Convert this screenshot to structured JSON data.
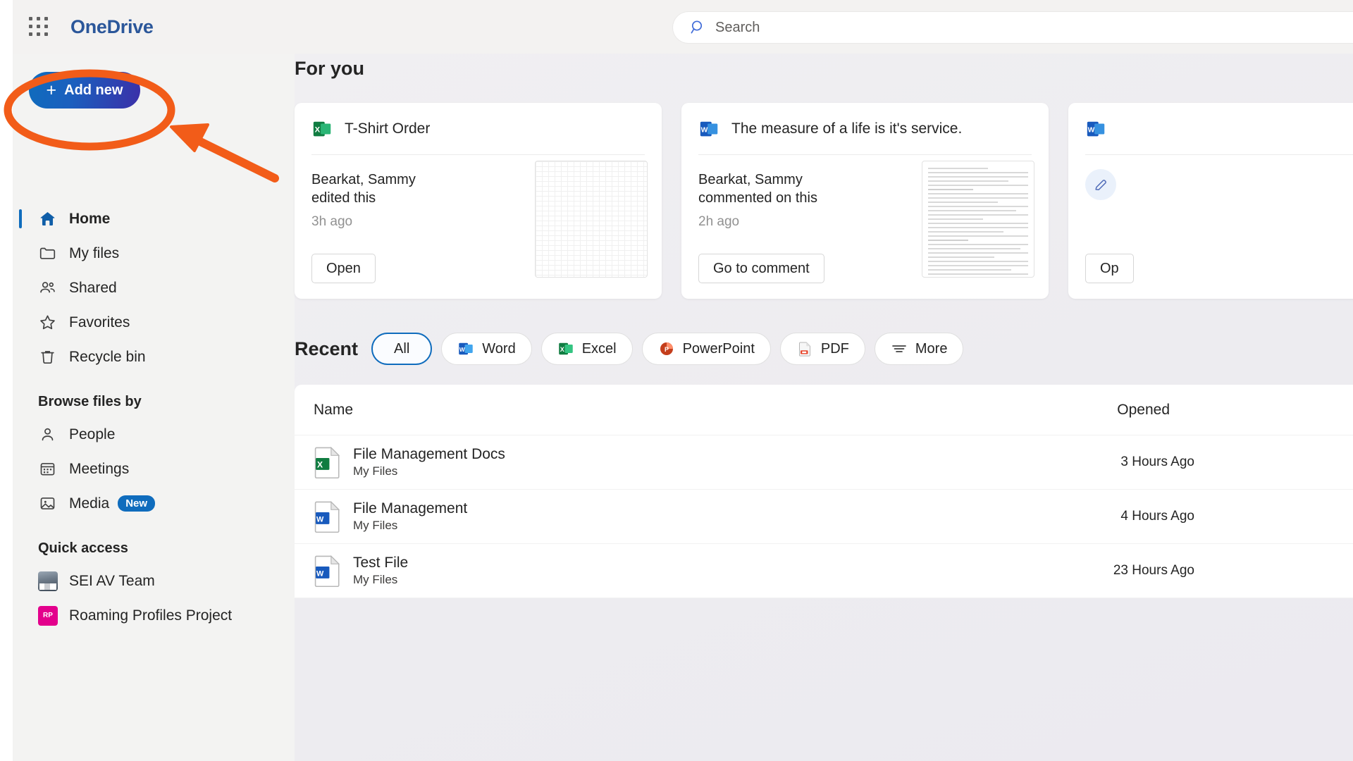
{
  "topbar": {
    "waffle_label": "app-launcher",
    "brand": "OneDrive",
    "search_placeholder": "Search"
  },
  "sidebar": {
    "add_new_label": "Add new",
    "nav": [
      {
        "label": "Home",
        "icon": "home-icon",
        "active": true
      },
      {
        "label": "My files",
        "icon": "folder-icon",
        "active": false
      },
      {
        "label": "Shared",
        "icon": "people-icon",
        "active": false
      },
      {
        "label": "Favorites",
        "icon": "star-icon",
        "active": false
      },
      {
        "label": "Recycle bin",
        "icon": "trash-icon",
        "active": false
      }
    ],
    "browse_heading": "Browse files by",
    "browse": [
      {
        "label": "People",
        "icon": "person-icon",
        "badge": ""
      },
      {
        "label": "Meetings",
        "icon": "calendar-icon",
        "badge": ""
      },
      {
        "label": "Media",
        "icon": "image-icon",
        "badge": "New"
      }
    ],
    "quick_heading": "Quick access",
    "quick": [
      {
        "label": "SEI AV Team",
        "icon": "photo-thumbnail-icon",
        "initials": ""
      },
      {
        "label": "Roaming Profiles Project",
        "icon": "site-icon",
        "initials": "RP"
      }
    ]
  },
  "main": {
    "for_you_heading": "For you",
    "cards": [
      {
        "title": "T-Shirt Order",
        "app_icon": "excel-icon",
        "actor": "Bearkat, Sammy\nedited this",
        "actor_line1": "Bearkat, Sammy",
        "actor_line2": "edited this",
        "when": "3h ago",
        "action_label": "Open",
        "thumb": "spreadsheet-grid"
      },
      {
        "title": "The measure of a life is it's service.",
        "app_icon": "word-icon",
        "actor_line1": "Bearkat, Sammy",
        "actor_line2": "commented on this",
        "when": "2h ago",
        "action_label": "Go to comment",
        "thumb": "document-page"
      },
      {
        "title": "",
        "app_icon": "word-icon",
        "actor_line1": "",
        "actor_line2": "",
        "when": "",
        "action_label": "Op",
        "thumb": "edit-pencil"
      }
    ],
    "filters": {
      "recent_label": "Recent",
      "pills": [
        {
          "label": "All",
          "icon": "",
          "selected": true
        },
        {
          "label": "Word",
          "icon": "word-icon",
          "selected": false
        },
        {
          "label": "Excel",
          "icon": "excel-icon",
          "selected": false
        },
        {
          "label": "PowerPoint",
          "icon": "powerpoint-icon",
          "selected": false
        },
        {
          "label": "PDF",
          "icon": "pdf-icon",
          "selected": false
        },
        {
          "label": "More",
          "icon": "filter-icon",
          "selected": false
        }
      ]
    },
    "table": {
      "columns": {
        "name": "Name",
        "opened": "Opened"
      },
      "rows": [
        {
          "name": "File Management Docs",
          "location": "My Files",
          "opened": "3 Hours Ago",
          "icon": "excel-file-icon"
        },
        {
          "name": "File Management",
          "location": "My Files",
          "opened": "4 Hours Ago",
          "icon": "word-file-icon"
        },
        {
          "name": "Test File",
          "location": "My Files",
          "opened": "23 Hours Ago",
          "icon": "word-file-icon"
        }
      ]
    }
  },
  "annotation": {
    "highlight_color": "#f25c19",
    "shape": "ellipse-around-add-new-with-arrow"
  }
}
